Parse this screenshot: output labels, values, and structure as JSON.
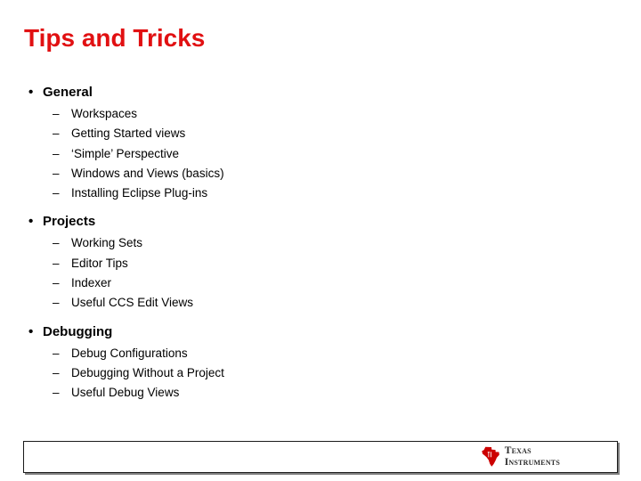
{
  "slide": {
    "title": "Tips and Tricks",
    "title_color": "#e11012",
    "background_color": "#ffffff",
    "bullet_marker": "•",
    "sub_marker": "–",
    "sections": [
      {
        "heading": "General",
        "items": [
          "Workspaces",
          "Getting Started views",
          "‘Simple’ Perspective",
          "Windows and Views (basics)",
          "Installing Eclipse Plug-ins"
        ]
      },
      {
        "heading": "Projects",
        "items": [
          "Working Sets",
          "Editor Tips",
          "Indexer",
          "Useful CCS Edit Views"
        ]
      },
      {
        "heading": "Debugging",
        "items": [
          "Debug Configurations",
          "Debugging Without a Project",
          "Useful Debug Views"
        ]
      }
    ]
  },
  "footer": {
    "logo": {
      "icon": "texas-state-shape-icon",
      "icon_color": "#cc0000",
      "line1": "Texas",
      "line2": "Instruments"
    }
  }
}
